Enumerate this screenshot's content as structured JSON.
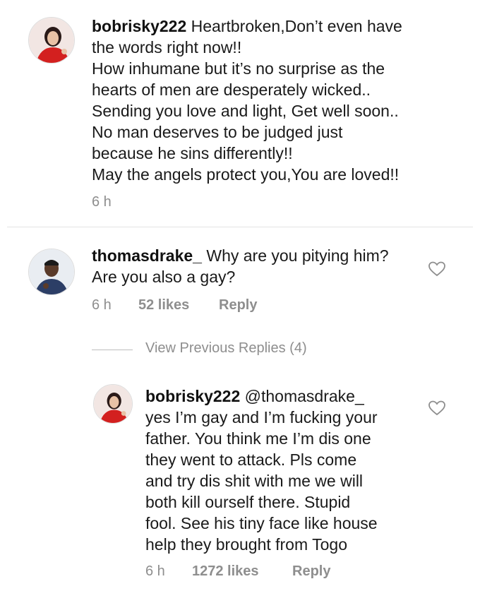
{
  "comments": [
    {
      "username": "bobrisky222",
      "text": " Heartbroken,Don’t even have\nthe words right now!!\nHow inhumane but it’s no surprise as the\nhearts of men are desperately wicked..\nSending you love and light, Get well soon..\nNo man deserves to be judged just\nbecause he sins differently!!\nMay the angels protect you,You are loved!!",
      "time": "6 h",
      "avatar_icon": "profile-photo-icon"
    },
    {
      "username": "thomasdrake_",
      "text": " Why are you pitying him?\nAre you also a gay?",
      "time": "6 h",
      "likes": "52 likes",
      "reply": "Reply",
      "avatar_icon": "profile-photo-icon"
    },
    {
      "username": "bobrisky222",
      "text": " @thomasdrake_\nyes I’m gay and I’m fucking your\nfather. You think me I’m dis one\nthey went to attack. Pls come\nand try dis shit with me we will\nboth kill ourself there. Stupid\nfool. See his tiny face like house\nhelp they brought from Togo",
      "time": "6 h",
      "likes": "1272 likes",
      "reply": "Reply",
      "avatar_icon": "profile-photo-icon"
    }
  ],
  "view_previous": "View Previous Replies (4)",
  "colors": {
    "meta": "#8e8e8e",
    "text": "#1a1a1a"
  },
  "icons": {
    "like": "heart-outline-icon"
  }
}
